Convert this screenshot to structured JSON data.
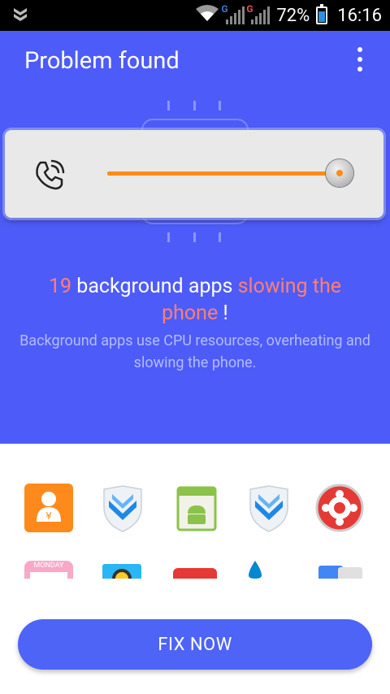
{
  "status_bar": {
    "battery": "72%",
    "time": "16:16",
    "sim1_label": "G",
    "sim2_label": "G"
  },
  "header": {
    "title": "Problem found",
    "menu_icon": "more-vert-icon"
  },
  "scan_card": {
    "icon": "phone-call-icon",
    "progress_fraction": 1.0
  },
  "headline": {
    "count": "19",
    "text_white": " background apps ",
    "text_red1": "slowing the",
    "text_red2": "phone",
    "suffix": " !"
  },
  "description": "Background apps use CPU resources, overheating and slowing the phone.",
  "apps_row1": [
    {
      "icon": "wallet-app-icon"
    },
    {
      "icon": "shield-app-icon"
    },
    {
      "icon": "android-app-icon"
    },
    {
      "icon": "shield-app-icon"
    },
    {
      "icon": "red-circle-app-icon"
    }
  ],
  "apps_row2": [
    {
      "icon": "calendar-app-icon",
      "label": "MONDAY"
    },
    {
      "icon": "camera-app-icon"
    },
    {
      "icon": "youtube-app-icon"
    },
    {
      "icon": "drop-app-icon"
    },
    {
      "icon": "translate-app-icon"
    }
  ],
  "fix_button": "FIX NOW",
  "colors": {
    "primary": "#4d5cf8",
    "accent": "#ff7f73",
    "progress": "#ff8c1a"
  }
}
